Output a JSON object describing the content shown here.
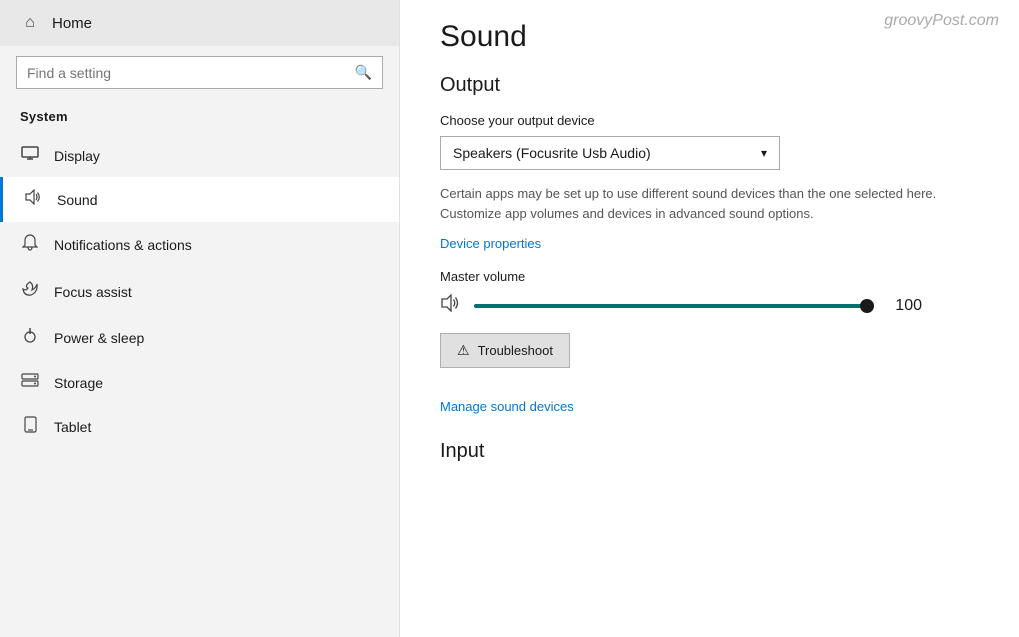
{
  "sidebar": {
    "home_label": "Home",
    "search_placeholder": "Find a setting",
    "system_label": "System",
    "items": [
      {
        "id": "display",
        "label": "Display",
        "icon": "🖥"
      },
      {
        "id": "sound",
        "label": "Sound",
        "icon": "🔊",
        "active": true
      },
      {
        "id": "notifications",
        "label": "Notifications & actions",
        "icon": "🔔"
      },
      {
        "id": "focus",
        "label": "Focus assist",
        "icon": "🌙"
      },
      {
        "id": "power",
        "label": "Power & sleep",
        "icon": "⏻"
      },
      {
        "id": "storage",
        "label": "Storage",
        "icon": "🗄"
      },
      {
        "id": "tablet",
        "label": "Tablet",
        "icon": "📱"
      }
    ]
  },
  "main": {
    "watermark": "groovyPost.com",
    "page_title": "Sound",
    "output_section": "Output",
    "choose_device_label": "Choose your output device",
    "device_name": "Speakers (Focusrite Usb Audio)",
    "description": "Certain apps may be set up to use different sound devices than the one selected here. Customize app volumes and devices in advanced sound options.",
    "device_properties_link": "Device properties",
    "master_volume_label": "Master volume",
    "volume_value": "100",
    "troubleshoot_label": "Troubleshoot",
    "manage_devices_link": "Manage sound devices",
    "input_section": "Input"
  }
}
